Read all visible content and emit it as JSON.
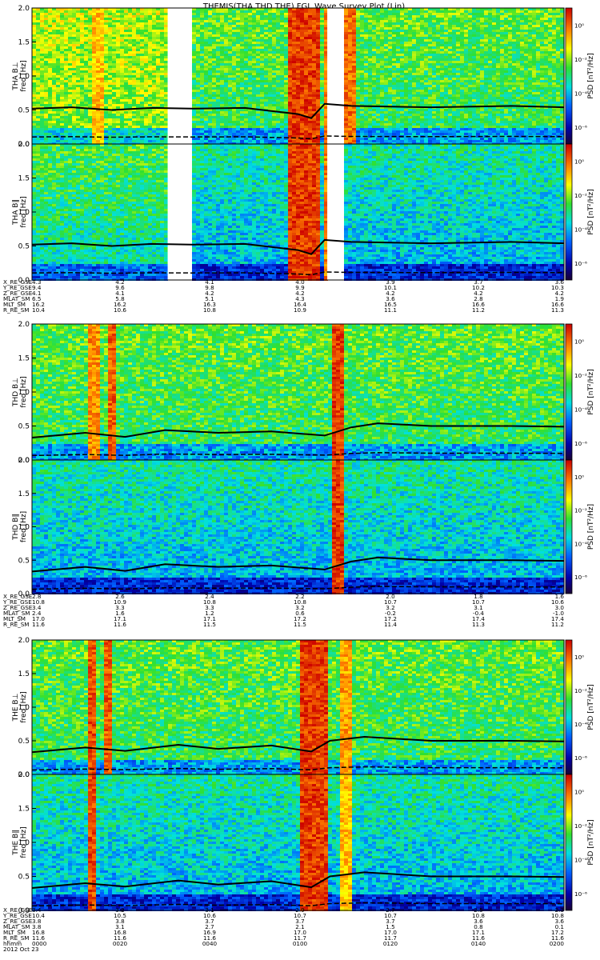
{
  "chart_data": {
    "type": "heatmap",
    "title": "THEMIS(THA,THD,THE) FGL Wave Survey Plot (Lin)",
    "ylabel_freq": "freq [Hz]",
    "colorbar_label": "PSD [nT²/Hz]",
    "ylim": [
      0,
      2.0
    ],
    "yticks": [
      "0.0",
      "0.5",
      "1.0",
      "1.5",
      "2.0"
    ],
    "colorbar_ticks": [
      "10⁰",
      "10⁻²",
      "10⁻⁴",
      "10⁻⁶"
    ],
    "colorbar_range_log": [
      -7,
      1
    ],
    "panels": [
      {
        "probe": "THA",
        "component": "B⊥",
        "label": "THA B⊥",
        "gaps": [
          [
            0.51,
            0.59
          ],
          [
            1.11,
            1.17
          ]
        ],
        "bursts": [
          [
            0.22,
            0.26,
            0.6
          ],
          [
            0.95,
            1.07,
            1.0
          ],
          [
            1.09,
            1.12,
            0.8
          ],
          [
            1.17,
            1.21,
            0.85
          ]
        ],
        "fce_curve": [
          [
            0.0,
            0.52
          ],
          [
            0.15,
            0.54
          ],
          [
            0.3,
            0.5
          ],
          [
            0.45,
            0.53
          ],
          [
            0.6,
            0.52
          ],
          [
            0.8,
            0.53
          ],
          [
            1.0,
            0.44
          ],
          [
            1.05,
            0.38
          ],
          [
            1.1,
            0.59
          ],
          [
            1.2,
            0.56
          ],
          [
            1.5,
            0.54
          ],
          [
            1.8,
            0.56
          ],
          [
            2.0,
            0.54
          ]
        ]
      },
      {
        "probe": "THA",
        "component": "B∥",
        "label": "THA B∥",
        "gaps": [
          [
            0.51,
            0.59
          ],
          [
            1.11,
            1.17
          ]
        ],
        "bursts": [
          [
            0.95,
            1.07,
            1.0
          ],
          [
            1.09,
            1.12,
            0.8
          ]
        ],
        "fce_curve": [
          [
            0.0,
            0.52
          ],
          [
            0.15,
            0.54
          ],
          [
            0.3,
            0.5
          ],
          [
            0.45,
            0.53
          ],
          [
            0.6,
            0.52
          ],
          [
            0.8,
            0.53
          ],
          [
            1.0,
            0.44
          ],
          [
            1.05,
            0.38
          ],
          [
            1.1,
            0.59
          ],
          [
            1.2,
            0.56
          ],
          [
            1.5,
            0.54
          ],
          [
            1.8,
            0.56
          ],
          [
            2.0,
            0.54
          ]
        ]
      },
      {
        "probe": "THD",
        "component": "B⊥",
        "label": "THD B⊥",
        "gaps": [],
        "bursts": [
          [
            0.2,
            0.25,
            0.75
          ],
          [
            0.28,
            0.31,
            0.9
          ],
          [
            1.12,
            1.16,
            1.0
          ]
        ],
        "fce_curve": [
          [
            0.0,
            0.33
          ],
          [
            0.2,
            0.4
          ],
          [
            0.35,
            0.34
          ],
          [
            0.5,
            0.44
          ],
          [
            0.7,
            0.4
          ],
          [
            0.9,
            0.42
          ],
          [
            1.1,
            0.36
          ],
          [
            1.2,
            0.48
          ],
          [
            1.3,
            0.54
          ],
          [
            1.5,
            0.5
          ],
          [
            1.8,
            0.5
          ],
          [
            2.0,
            0.49
          ]
        ]
      },
      {
        "probe": "THD",
        "component": "B∥",
        "label": "THD B∥",
        "gaps": [],
        "bursts": [
          [
            1.12,
            1.16,
            1.0
          ]
        ],
        "fce_curve": [
          [
            0.0,
            0.33
          ],
          [
            0.2,
            0.4
          ],
          [
            0.35,
            0.34
          ],
          [
            0.5,
            0.44
          ],
          [
            0.7,
            0.4
          ],
          [
            0.9,
            0.42
          ],
          [
            1.1,
            0.36
          ],
          [
            1.2,
            0.48
          ],
          [
            1.3,
            0.54
          ],
          [
            1.5,
            0.5
          ],
          [
            1.8,
            0.5
          ],
          [
            2.0,
            0.49
          ]
        ]
      },
      {
        "probe": "THE",
        "component": "B⊥",
        "label": "THE B⊥",
        "gaps": [],
        "bursts": [
          [
            0.2,
            0.24,
            0.95
          ],
          [
            0.27,
            0.3,
            0.9
          ],
          [
            1.0,
            1.11,
            1.0
          ],
          [
            1.15,
            1.2,
            0.7
          ]
        ],
        "fce_curve": [
          [
            0.0,
            0.33
          ],
          [
            0.2,
            0.4
          ],
          [
            0.35,
            0.35
          ],
          [
            0.55,
            0.44
          ],
          [
            0.7,
            0.38
          ],
          [
            0.9,
            0.43
          ],
          [
            1.05,
            0.34
          ],
          [
            1.12,
            0.5
          ],
          [
            1.25,
            0.56
          ],
          [
            1.5,
            0.5
          ],
          [
            1.8,
            0.5
          ],
          [
            2.0,
            0.49
          ]
        ]
      },
      {
        "probe": "THE",
        "component": "B∥",
        "label": "THE B∥",
        "gaps": [],
        "bursts": [
          [
            0.2,
            0.24,
            0.95
          ],
          [
            1.0,
            1.11,
            1.0
          ],
          [
            1.15,
            1.2,
            0.6
          ]
        ],
        "fce_curve": [
          [
            0.0,
            0.33
          ],
          [
            0.2,
            0.4
          ],
          [
            0.35,
            0.35
          ],
          [
            0.55,
            0.44
          ],
          [
            0.7,
            0.38
          ],
          [
            0.9,
            0.43
          ],
          [
            1.05,
            0.34
          ],
          [
            1.12,
            0.5
          ],
          [
            1.25,
            0.56
          ],
          [
            1.5,
            0.5
          ],
          [
            1.8,
            0.5
          ],
          [
            2.0,
            0.49
          ]
        ]
      }
    ],
    "ephemeris": [
      {
        "probe": "THA",
        "labels": [
          "X_RE_GSE",
          "Y_RE_GSE",
          "Z_RE_GSE",
          "MLAT_SM",
          "MLT_SM",
          "R_RE_SM"
        ],
        "values": [
          [
            "4.3",
            "4.2",
            "4.1",
            "4.0",
            "3.9",
            "3.7",
            "3.6"
          ],
          [
            "9.4",
            "9.6",
            "9.8",
            "9.9",
            "10.1",
            "10.2",
            "10.3"
          ],
          [
            "4.1",
            "4.1",
            "4.2",
            "4.2",
            "4.2",
            "4.2",
            "4.2"
          ],
          [
            "6.5",
            "5.8",
            "5.1",
            "4.3",
            "3.6",
            "2.8",
            "1.9"
          ],
          [
            "16.2",
            "16.2",
            "16.3",
            "16.4",
            "16.5",
            "16.6",
            "16.6"
          ],
          [
            "10.4",
            "10.6",
            "10.8",
            "10.9",
            "11.1",
            "11.2",
            "11.3"
          ]
        ]
      },
      {
        "probe": "THD",
        "labels": [
          "X_RE_GSE",
          "Y_RE_GSE",
          "Z_RE_GSE",
          "MLAT_SM",
          "MLT_SM",
          "R_RE_SM"
        ],
        "values": [
          [
            "2.8",
            "2.6",
            "2.4",
            "2.2",
            "2.0",
            "1.8",
            "1.6"
          ],
          [
            "10.8",
            "10.9",
            "10.8",
            "10.8",
            "10.7",
            "10.7",
            "10.6"
          ],
          [
            "3.4",
            "3.3",
            "3.3",
            "3.2",
            "3.2",
            "3.1",
            "3.0"
          ],
          [
            "2.4",
            "1.6",
            "1.2",
            "0.6",
            "-0.2",
            "-0.4",
            "-1.0"
          ],
          [
            "17.0",
            "17.1",
            "17.1",
            "17.2",
            "17.2",
            "17.4",
            "17.4"
          ],
          [
            "11.6",
            "11.6",
            "11.5",
            "11.5",
            "11.4",
            "11.3",
            "11.2"
          ]
        ]
      },
      {
        "probe": "THE",
        "labels": [
          "X_RE_GSE",
          "Y_RE_GSE",
          "Z_RE_GSE",
          "MLAT_SM",
          "MLT_SM",
          "R_RE_SM",
          "hhmm"
        ],
        "values": [
          [
            "3.4",
            "3.2",
            "3.1",
            "2.9",
            "2.7",
            "2.5",
            "2.3"
          ],
          [
            "10.4",
            "10.5",
            "10.6",
            "10.7",
            "10.7",
            "10.8",
            "10.8"
          ],
          [
            "3.8",
            "3.8",
            "3.7",
            "3.7",
            "3.7",
            "3.6",
            "3.6"
          ],
          [
            "3.8",
            "3.1",
            "2.7",
            "2.1",
            "1.5",
            "0.8",
            "0.1"
          ],
          [
            "16.8",
            "16.8",
            "16.9",
            "17.0",
            "17.0",
            "17.1",
            "17.2"
          ],
          [
            "11.6",
            "11.6",
            "11.6",
            "11.7",
            "11.7",
            "11.6",
            "11.6"
          ],
          [
            "0000",
            "0020",
            "0040",
            "0100",
            "0120",
            "0140",
            "0200"
          ]
        ]
      }
    ],
    "date": "2012 Oct 23"
  }
}
